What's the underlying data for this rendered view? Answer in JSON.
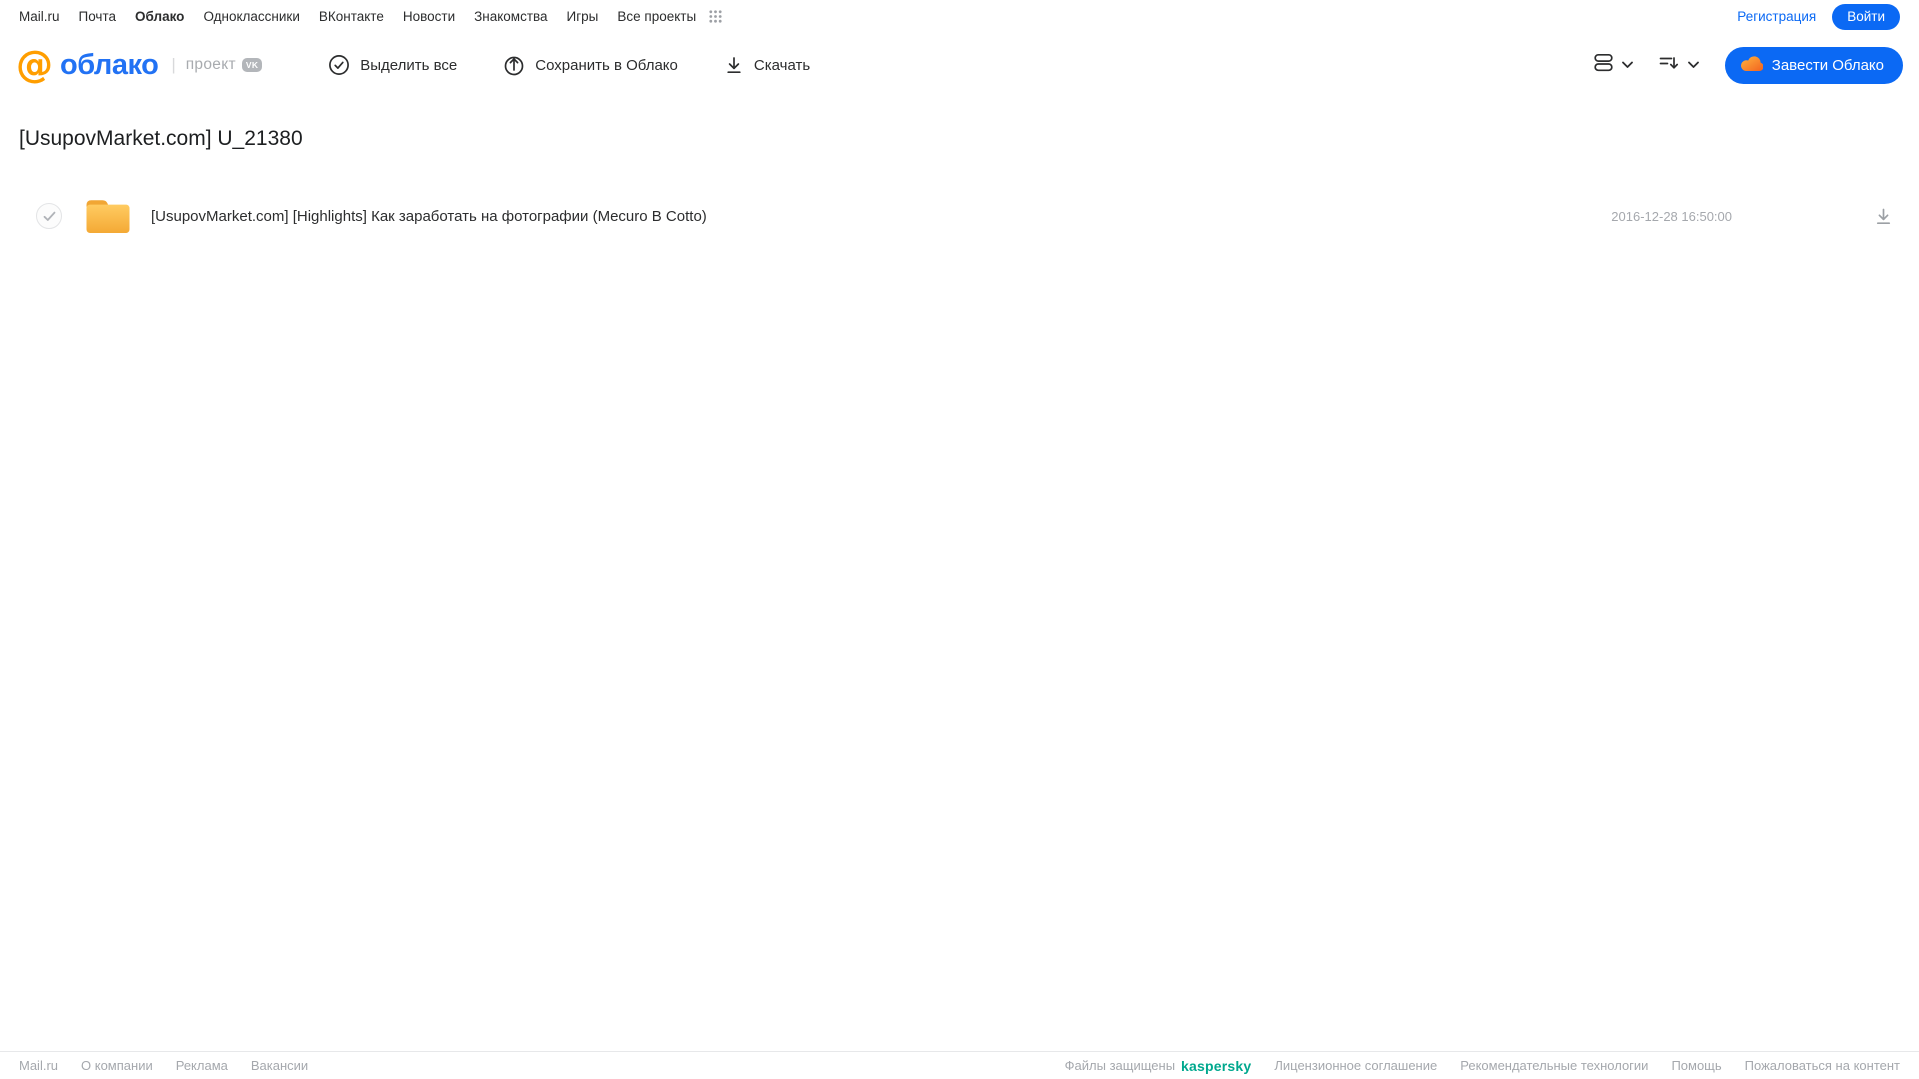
{
  "portal_nav": {
    "links": [
      "Mail.ru",
      "Почта",
      "Облако",
      "Одноклассники",
      "ВКонтакте",
      "Новости",
      "Знакомства",
      "Игры",
      "Все проекты"
    ],
    "registration": "Регистрация",
    "login": "Войти"
  },
  "header": {
    "logo_at": "@",
    "logo_text": "облако",
    "project_label": "проект",
    "vk_badge": "VK",
    "toolbar": [
      {
        "label": "Выделить все",
        "icon": "check-circle-icon"
      },
      {
        "label": "Сохранить в Облако",
        "icon": "cloud-upload-icon"
      },
      {
        "label": "Скачать",
        "icon": "download-icon"
      }
    ],
    "create_cloud_button": "Завести Облако"
  },
  "main": {
    "title": "[UsupovMarket.com] U_21380",
    "files": [
      {
        "type": "folder",
        "name": "[UsupovMarket.com] [Highlights] Как заработать на фотографии (Mecuro B Cotto)",
        "date": "2016-12-28 16:50:00"
      }
    ]
  },
  "footer": {
    "links_left": [
      "Mail.ru",
      "О компании",
      "Реклама",
      "Вакансии"
    ],
    "protected_prefix": "Файлы защищены",
    "kaspersky": "kaspersky",
    "links_right": [
      "Лицензионное соглашение",
      "Рекомендательные технологии",
      "Помощь",
      "Пожаловаться на контент"
    ]
  },
  "colors": {
    "accent_blue": "#0b69f4",
    "kaspersky_green": "#00a88e",
    "folder_yellow": "#f7b239",
    "logo_orange": "#ff9e00"
  }
}
